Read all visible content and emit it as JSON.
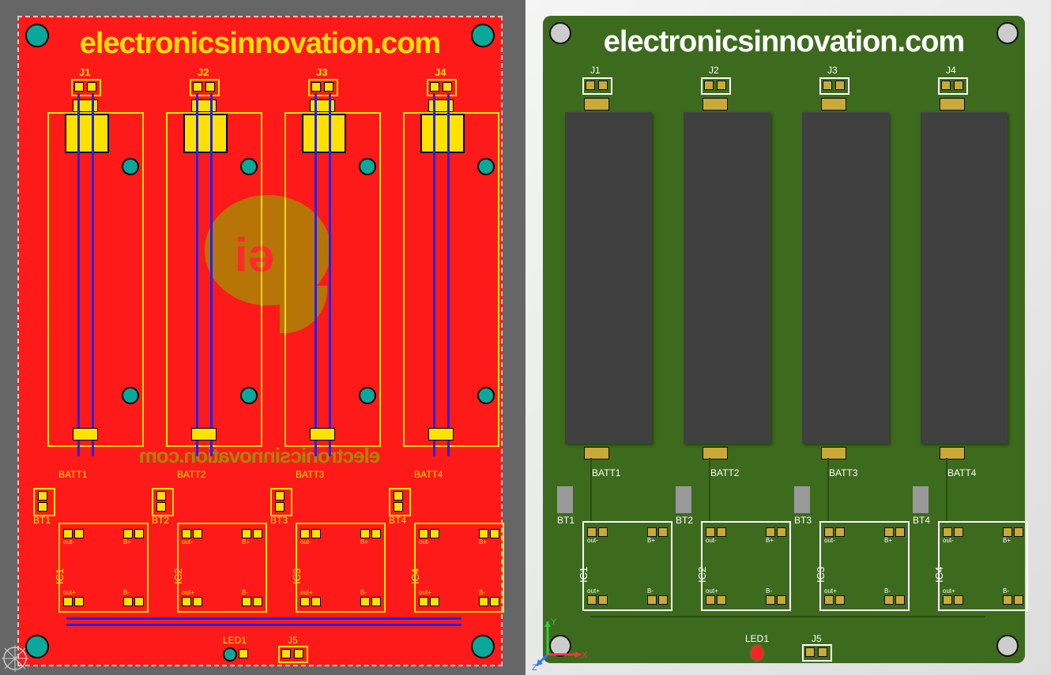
{
  "brand_text": "electronicsinnovation.com",
  "left_view": {
    "connectors_top": [
      "J1",
      "J2",
      "J3",
      "J4"
    ],
    "batteries": [
      "BATT1",
      "BATT2",
      "BATT3",
      "BATT4"
    ],
    "bt": [
      "BT1",
      "BT2",
      "BT3",
      "BT4"
    ],
    "ics": [
      "IC1",
      "IC2",
      "IC3",
      "IC4"
    ],
    "ic_pin_labels": {
      "out_minus": "out-",
      "out_plus": "out+",
      "b_minus": "B-",
      "b_plus": "B+"
    },
    "led": "LED1",
    "bottom_conn": "J5",
    "logo_text": "iə"
  },
  "right_view": {
    "connectors_top": [
      "J1",
      "J2",
      "J3",
      "J4"
    ],
    "batteries": [
      "BATT1",
      "BATT2",
      "BATT3",
      "BATT4"
    ],
    "bt": [
      "BT1",
      "BT2",
      "BT3",
      "BT4"
    ],
    "ics": [
      "IC1",
      "IC2",
      "IC3",
      "IC4"
    ],
    "ic_pin_labels": {
      "out_minus": "out-",
      "out_plus": "out+",
      "b_minus": "B-",
      "b_plus": "B+"
    },
    "led": "LED1",
    "bottom_conn": "J5",
    "axes": {
      "x": "X",
      "y": "Y",
      "z": "Z"
    }
  }
}
